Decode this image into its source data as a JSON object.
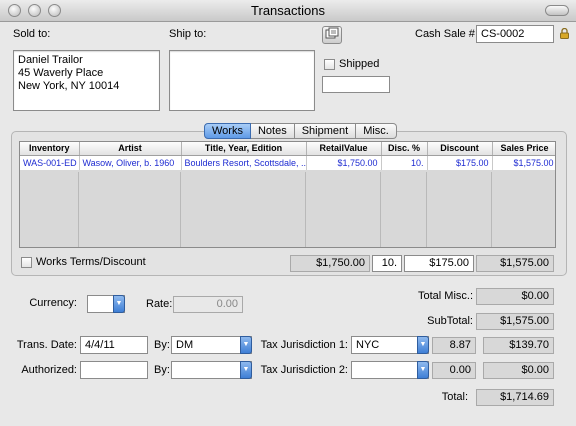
{
  "window": {
    "title": "Transactions"
  },
  "sold_to": {
    "label": "Sold to:",
    "lines": [
      "Daniel Trailor",
      "45 Waverly Place",
      "New York, NY  10014"
    ]
  },
  "ship_to": {
    "label": "Ship to:"
  },
  "shipped": {
    "label": "Shipped",
    "checked": false,
    "value": ""
  },
  "cash_sale": {
    "label": "Cash Sale #",
    "value": "CS-0002"
  },
  "tabs": [
    "Works",
    "Notes",
    "Shipment",
    "Misc."
  ],
  "active_tab": "Works",
  "works_table": {
    "columns": [
      "Inventory",
      "Artist",
      "Title, Year, Edition",
      "RetailValue",
      "Disc. %",
      "Discount",
      "Sales Price"
    ],
    "rows": [
      [
        "WAS-001-ED",
        "Wasow, Oliver, b. 1960",
        "Boulders Resort, Scottsdale, ...",
        "$1,750.00",
        "10.",
        "$175.00",
        "$1,575.00"
      ]
    ]
  },
  "works_terms": {
    "label": "Works Terms/Discount",
    "checked": false
  },
  "totals_row": {
    "retail": "$1,750.00",
    "disc_pct": "10.",
    "discount": "$175.00",
    "sales": "$1,575.00"
  },
  "currency": {
    "label": "Currency:",
    "value": ""
  },
  "rate": {
    "label": "Rate:",
    "value": "0.00"
  },
  "total_misc": {
    "label": "Total Misc.:",
    "value": "$0.00"
  },
  "subtotal": {
    "label": "SubTotal:",
    "value": "$1,575.00"
  },
  "trans_date": {
    "label": "Trans. Date:",
    "value": "4/4/11"
  },
  "trans_by": {
    "label": "By:",
    "value": "DM"
  },
  "tax1": {
    "label": "Tax Jurisdiction 1:",
    "value": "NYC",
    "rate": "8.87",
    "amount": "$139.70"
  },
  "authorized": {
    "label": "Authorized:",
    "value": ""
  },
  "auth_by": {
    "label": "By:",
    "value": ""
  },
  "tax2": {
    "label": "Tax Jurisdiction 2:",
    "value": "",
    "rate": "0.00",
    "amount": "$0.00"
  },
  "total": {
    "label": "Total:",
    "value": "$1,714.69"
  }
}
